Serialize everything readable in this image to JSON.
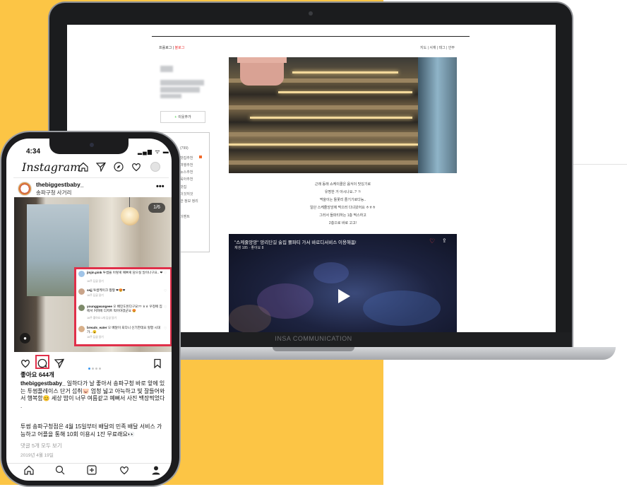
{
  "colors": {
    "background_yellow": "#fcc545",
    "instagram_highlight": "#e0304a",
    "blog_active_tab": "#ee3333"
  },
  "laptop": {
    "brand": "INSA COMMUNICATION",
    "blog": {
      "tabs": {
        "prologue": "프롤로그",
        "separator": "|",
        "blog": "블로그"
      },
      "top_links": "지도 | 서재 | 태그 | 안부",
      "follow_button": {
        "plus": "+",
        "label": "이웃추가"
      },
      "category_items": [
        "(799)",
        "맛집추천",
        "여행추천",
        "뉴스추천",
        "육아추천",
        "맛집",
        "이것저것",
        "한 정보 정리",
        "이벤트"
      ],
      "post_lines": [
        "근래 동래 쇼케이쿨은 음식이 맛있기로",
        "유명한 거 아시나요..? ㅋ",
        "먹을이는 들꽃리 즐기기로다능..",
        "일단 스케줄앙앙에 먹으러 다녀왔어요 ㅎㅎㅎ",
        "그러서 들파티하는 1층 찍스하고",
        "2층으로 바로 고고!"
      ],
      "video": {
        "title": "\"스케줄앙앙\" 앙리단길 술집 쫄파티 가서 바로디서비스 이용해봄!",
        "meta": "재생 185 · 좋아요 8",
        "heart_icon": "heart-icon",
        "share_icon": "share-icon"
      }
    }
  },
  "phone": {
    "status_time": "4:34",
    "status_icons": "▂▄▆ ᯤ ▬",
    "app_title": "Instagram",
    "post": {
      "username": "thebiggestbaby_",
      "location": "송파구청 사거리",
      "more": "•••",
      "image_counter": "1/6",
      "tag_icon_glyph": "●",
      "comments": [
        {
          "user": "jinjin.pink",
          "text": "투썸을 이렇게 예쁘게 담으실 일이나구요.. ❤",
          "meta": "16주   답글 달기",
          "color": "#a0c4e8"
        },
        {
          "user": "sejj",
          "text": "투썸케이크 짱짱 ❤😍❤",
          "meta": "16주   답글 달기",
          "color": "#c9a48a"
        },
        {
          "user": "younggwangeee",
          "text": "오 배민도된다구요?? ㅎㅎ 우정에 집에서 커피에 디저트 먹어야겠군요 😍",
          "meta": "16주   좋아요 1개   답글 달기",
          "color": "#7d8a6a"
        },
        {
          "user": "breads_eater",
          "text": "오 배달이 되다니 신기한데요 헐헝 시대가...😮",
          "meta": "16주   답글 달기",
          "color": "#d8b08a"
        }
      ],
      "likes": "좋아요 644개",
      "caption_user": "thebiggestbaby_",
      "caption_text": " 일하다가 날 좋아서 송파구청 바로 앞에 있는 투썸플레이스 단거 섭취🐷 엄청 넓고 아늑하고 빛 잘들어와서 행복함😊 세상 밥이 너무 여름같고 예뻐서 사진 백장찍었다",
      "caption_dot": ".",
      "caption_text2": "투썸 송파구청점은 4월 15일부터 배달의 민족 배달 서비스 가능하고 어플을 통해 10회 이용시 1잔 무료래요👀",
      "view_comments": "댓글 5개 모두 보기",
      "date": "2019년 4월 19일"
    }
  }
}
